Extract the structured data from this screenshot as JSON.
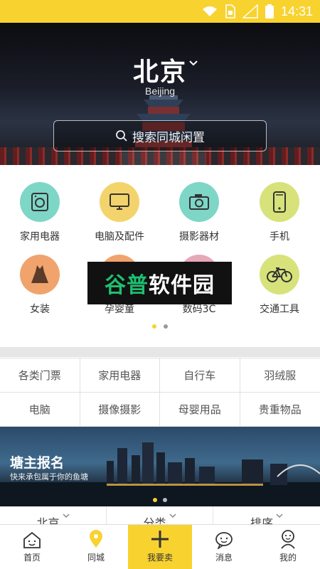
{
  "status_bar": {
    "time": "14:31"
  },
  "hero": {
    "city": "北京",
    "city_en": "Beijing",
    "search_placeholder": "搜索同城闲置"
  },
  "categories": [
    {
      "label": "家用电器",
      "icon": "washing-machine-icon",
      "color": "#7ed6c6"
    },
    {
      "label": "电脑及配件",
      "icon": "monitor-icon",
      "color": "#f3d36b"
    },
    {
      "label": "摄影器材",
      "icon": "camera-icon",
      "color": "#7ed6c6"
    },
    {
      "label": "手机",
      "icon": "phone-icon",
      "color": "#d7e27a"
    },
    {
      "label": "女装",
      "icon": "dress-icon",
      "color": "#f0a36c"
    },
    {
      "label": "孕婴童",
      "icon": "baby-icon",
      "color": "#f0a36c"
    },
    {
      "label": "数码3C",
      "icon": "headphones-icon",
      "color": "#e7a8b8"
    },
    {
      "label": "交通工具",
      "icon": "bicycle-icon",
      "color": "#d7e27a"
    }
  ],
  "watermark": {
    "part1": "谷普",
    "part2": "软件园"
  },
  "tags": [
    "各类门票",
    "家用电器",
    "自行车",
    "羽绒服",
    "电脑",
    "摄像摄影",
    "母婴用品",
    "贵重物品"
  ],
  "banner": {
    "title": "塘主报名",
    "subtitle": "快来承包属于你的鱼塘"
  },
  "filters": [
    "北京",
    "分类",
    "排序"
  ],
  "nav": [
    {
      "label": "首页",
      "icon": "home-icon"
    },
    {
      "label": "同城",
      "icon": "location-icon"
    },
    {
      "label": "我要卖",
      "icon": "plus-icon"
    },
    {
      "label": "消息",
      "icon": "message-icon"
    },
    {
      "label": "我的",
      "icon": "profile-icon"
    }
  ],
  "colors": {
    "accent": "#f8d22f"
  }
}
